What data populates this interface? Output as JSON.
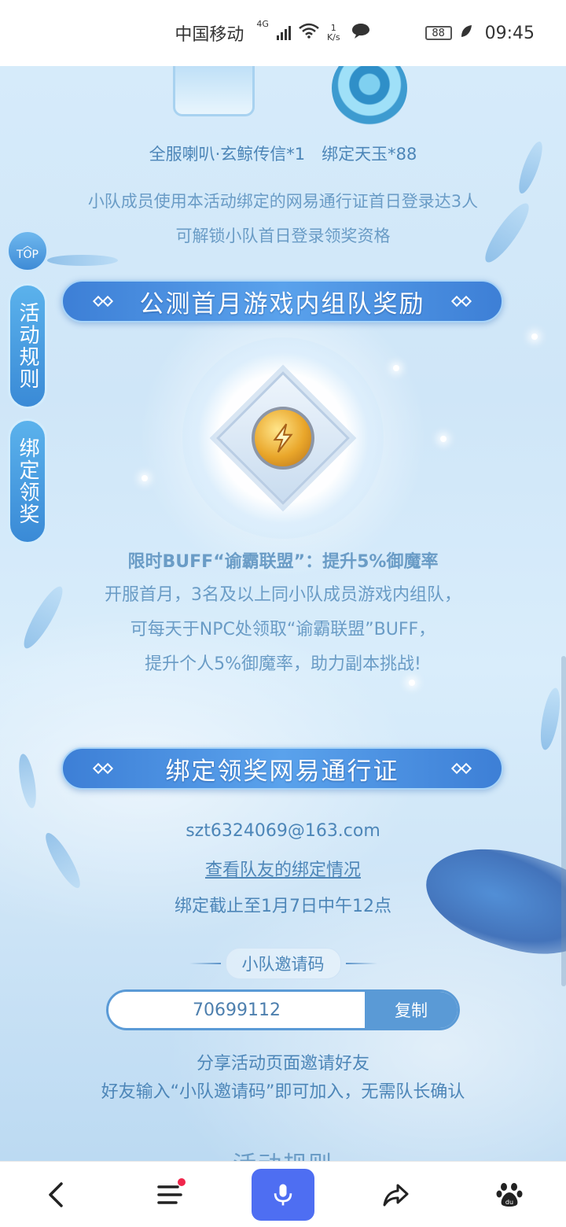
{
  "status_bar": {
    "carrier": "中国移动",
    "network_type": "4G",
    "speed_value": "1",
    "speed_unit": "K/s",
    "battery": "88",
    "time": "09:45"
  },
  "reward_section": {
    "rewards_line": "全服喇叭·玄鲸传信*1　绑定天玉*88",
    "condition_line1": "小队成员使用本活动绑定的网易通行证首日登录达3人",
    "condition_line2": "可解锁小队首日登录领奖资格"
  },
  "team_section": {
    "banner_title": "公测首月游戏内组队奖励",
    "buff_title": "限时BUFF“谕霸联盟”：提升5%御魔率",
    "line1": "开服首月，3名及以上同小队成员游戏内组队，",
    "line2": "可每天于NPC处领取“谕霸联盟”BUFF，",
    "line3": "提升个人5%御魔率，助力副本挑战!"
  },
  "bind_section": {
    "banner_title": "绑定领奖网易通行证",
    "email": "szt6324069@163.com",
    "teammate_link": "查看队友的绑定情况",
    "deadline": "绑定截止至1月7日中午12点",
    "invite_label": "小队邀请码",
    "invite_code": "70699112",
    "copy_label": "复制",
    "share_line1": "分享活动页面邀请好友",
    "share_line2": "好友输入“小队邀请码”即可加入，无需队长确认",
    "next_section_peek": "活动规则"
  },
  "side_buttons": {
    "top_label": "TOP",
    "rules_label": "活动规则",
    "bind_label": "绑定领奖"
  },
  "bottom_nav": {
    "icons": [
      "back-icon",
      "menu-icon",
      "microphone-icon",
      "share-icon",
      "baidu-paw-icon"
    ]
  },
  "colors": {
    "banner_blue": "#3d7fd6",
    "text_blue": "#4d86b8",
    "mic_blue": "#4e6ef2",
    "notification_red": "#f0264b"
  }
}
